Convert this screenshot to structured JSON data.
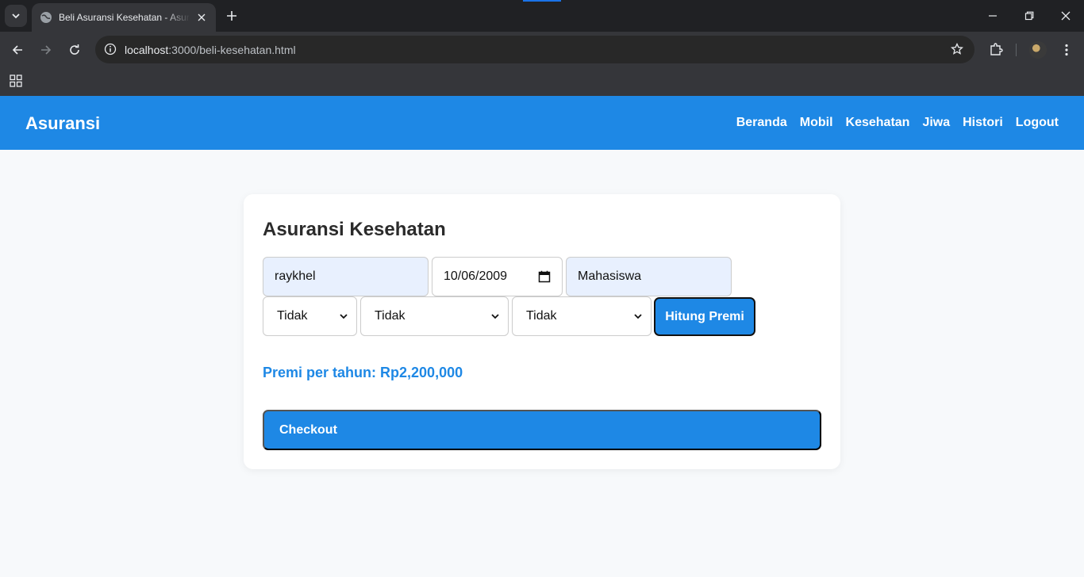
{
  "browser": {
    "tab_title": "Beli Asuransi Kesehatan - Asuransi",
    "url_host": "localhost",
    "url_rest": ":3000/beli-kesehatan.html"
  },
  "navbar": {
    "brand": "Asuransi",
    "links": [
      "Beranda",
      "Mobil",
      "Kesehatan",
      "Jiwa",
      "Histori",
      "Logout"
    ]
  },
  "form": {
    "title": "Asuransi Kesehatan",
    "name_value": "raykhel",
    "dob_value": "10/06/2009",
    "job_value": "Mahasiswa",
    "select_1": "Tidak",
    "select_2": "Tidak",
    "select_3": "Tidak",
    "hitung_label": "Hitung Premi",
    "premi_text": "Premi per tahun: Rp2,200,000",
    "checkout_label": "Checkout"
  },
  "colors": {
    "primary": "#1e88e5",
    "input_fill": "#e8f0fe"
  }
}
